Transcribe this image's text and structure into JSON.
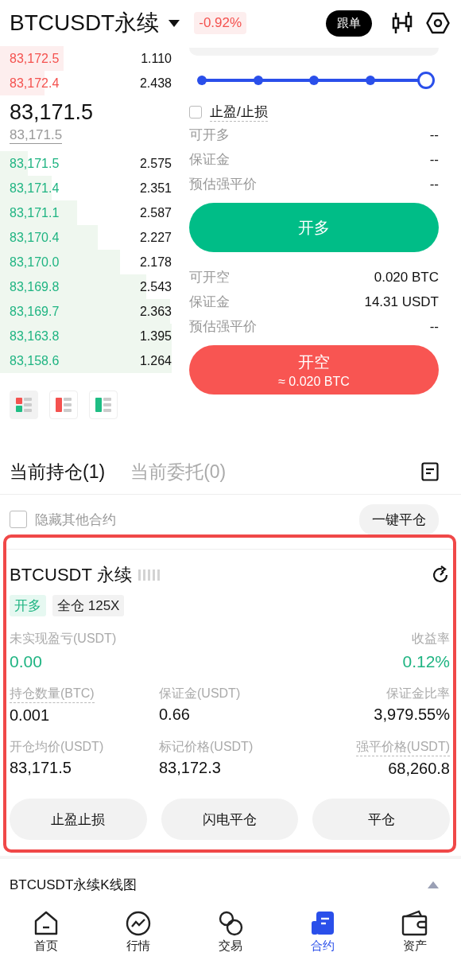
{
  "header": {
    "symbol": "BTCUSDT永续",
    "change": "-0.92%",
    "copy_button": "跟单"
  },
  "order_book": {
    "asks": [
      {
        "price": "83,172.5",
        "qty": "1.110"
      },
      {
        "price": "83,172.4",
        "qty": "2.438"
      }
    ],
    "last_price": "83,171.5",
    "mark_price": "83,171.5",
    "bids": [
      {
        "price": "83,171.5",
        "qty": "2.575"
      },
      {
        "price": "83,171.4",
        "qty": "2.351"
      },
      {
        "price": "83,171.1",
        "qty": "2.587"
      },
      {
        "price": "83,170.4",
        "qty": "2.227"
      },
      {
        "price": "83,170.0",
        "qty": "2.178"
      },
      {
        "price": "83,169.8",
        "qty": "2.543"
      },
      {
        "price": "83,169.7",
        "qty": "2.363"
      },
      {
        "price": "83,163.8",
        "qty": "1.395"
      },
      {
        "price": "83,158.6",
        "qty": "1.264"
      }
    ],
    "view_modes": [
      {
        "kind": "both",
        "selected": true
      },
      {
        "kind": "asks",
        "selected": false
      },
      {
        "kind": "bids",
        "selected": false
      }
    ]
  },
  "order_form": {
    "leverage_slider": {
      "level": 1
    },
    "tp_sl": {
      "label": "止盈/止损",
      "checked": false
    },
    "long_info": [
      {
        "label": "可开多",
        "value": "--"
      },
      {
        "label": "保证金",
        "value": "--"
      },
      {
        "label": "预估强平价",
        "value": "--"
      }
    ],
    "long_button": {
      "label": "开多"
    },
    "short_info": [
      {
        "label": "可开空",
        "value": "0.020 BTC"
      },
      {
        "label": "保证金",
        "value": "14.31 USDT"
      },
      {
        "label": "预估强平价",
        "value": "--"
      }
    ],
    "short_button": {
      "label": "开空",
      "sub": "≈ 0.020 BTC"
    }
  },
  "tabs": [
    {
      "label": "当前持仓(1)",
      "selected": true
    },
    {
      "label": "当前委托(0)",
      "selected": false
    }
  ],
  "hide_other": {
    "label": "隐藏其他合约",
    "checked": false
  },
  "close_all_button": "一键平仓",
  "position": {
    "highlighted": true,
    "symbol": "BTCUSDT 永续",
    "side": "开多",
    "margin_mode": "全仓 125X",
    "pnl": [
      {
        "label": "未实现盈亏(USDT)",
        "value": "0.00"
      },
      {
        "label": "收益率",
        "value": "0.12%"
      }
    ],
    "stats": [
      {
        "label": "持仓数量(BTC)",
        "value": "0.001",
        "hint": true
      },
      {
        "label": "保证金(USDT)",
        "value": "0.66",
        "hint": false
      },
      {
        "label": "保证金比率",
        "value": "3,979.55%",
        "hint": false
      },
      {
        "label": "开仓均价(USDT)",
        "value": "83,171.5",
        "hint": false
      },
      {
        "label": "标记价格(USDT)",
        "value": "83,172.3",
        "hint": false
      },
      {
        "label": "强平价格(USDT)",
        "value": "68,260.8",
        "hint": true
      }
    ],
    "actions": [
      "止盈止损",
      "闪电平仓",
      "平仓"
    ]
  },
  "chart_bar": {
    "label": "BTCUSDT永续K线图",
    "expanded": false
  },
  "nav": [
    {
      "label": "首页",
      "selected": false
    },
    {
      "label": "行情",
      "selected": false
    },
    {
      "label": "交易",
      "selected": false
    },
    {
      "label": "合约",
      "selected": true
    },
    {
      "label": "资产",
      "selected": false
    }
  ]
}
